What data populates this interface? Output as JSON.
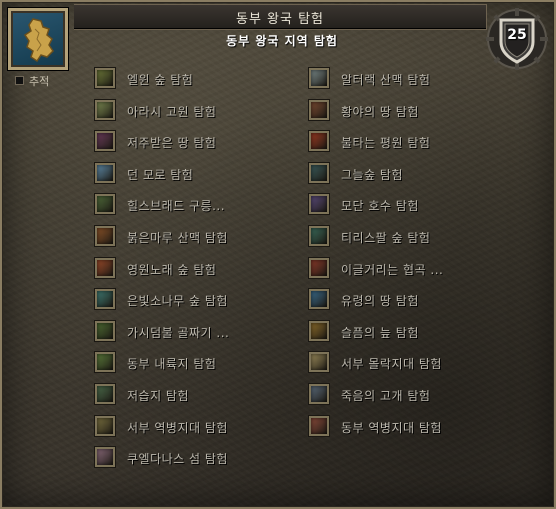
{
  "header": {
    "title": "동부 왕국 탐험"
  },
  "subtitle": "동부 왕국 지역 탐험",
  "tracking": {
    "label": "추적",
    "checked": false
  },
  "achievement_points": "25",
  "colors": {
    "panel": "#3f3a2f",
    "border": "#8a7d62",
    "text": "#bcb8ad"
  },
  "left_column": [
    {
      "label": "엘윈 숲 탐험",
      "color": "#6e7a3a"
    },
    {
      "label": "아라시 고원 탐험",
      "color": "#7c8a52"
    },
    {
      "label": "저주받은 땅 탐험",
      "color": "#6a3b5a"
    },
    {
      "label": "던 모로 탐험",
      "color": "#5d89a6"
    },
    {
      "label": "힐스브래드 구릉...",
      "color": "#4f6a3a"
    },
    {
      "label": "붉은마루 산맥 탐험",
      "color": "#8a5228"
    },
    {
      "label": "영원노래 숲 탐험",
      "color": "#9a4a2a"
    },
    {
      "label": "은빛소나무 숲 탐험",
      "color": "#3f7a72"
    },
    {
      "label": "가시덤불 골짜기 ...",
      "color": "#4c6a32"
    },
    {
      "label": "동부 내륙지 탐험",
      "color": "#5a7a3a"
    },
    {
      "label": "저습지 탐험",
      "color": "#4a6a4a"
    },
    {
      "label": "서부 역병지대 탐험",
      "color": "#7a7040"
    },
    {
      "label": "쿠엘다나스 섬 탐험",
      "color": "#8a6a7a"
    }
  ],
  "right_column": [
    {
      "label": "알터랙 산맥 탐험",
      "color": "#7a8a8a"
    },
    {
      "label": "황야의 땅 탐험",
      "color": "#7a4a32"
    },
    {
      "label": "불타는 평원 탐험",
      "color": "#9a3a22"
    },
    {
      "label": "그늘숲 탐험",
      "color": "#3a5a5a"
    },
    {
      "label": "모단 호수 탐험",
      "color": "#5a4a7a"
    },
    {
      "label": "티리스팔 숲 탐험",
      "color": "#3a6a5a"
    },
    {
      "label": "이글거리는 협곡 ...",
      "color": "#8a3a2a"
    },
    {
      "label": "유령의 땅 탐험",
      "color": "#3a6a8a"
    },
    {
      "label": "슬픔의 늪 탐험",
      "color": "#8a6a2a"
    },
    {
      "label": "서부 몰락지대 탐험",
      "color": "#9a8a5a"
    },
    {
      "label": "죽음의 고개 탐험",
      "color": "#5a6a7a"
    },
    {
      "label": "동부 역병지대 탐험",
      "color": "#8a4a3a"
    }
  ]
}
